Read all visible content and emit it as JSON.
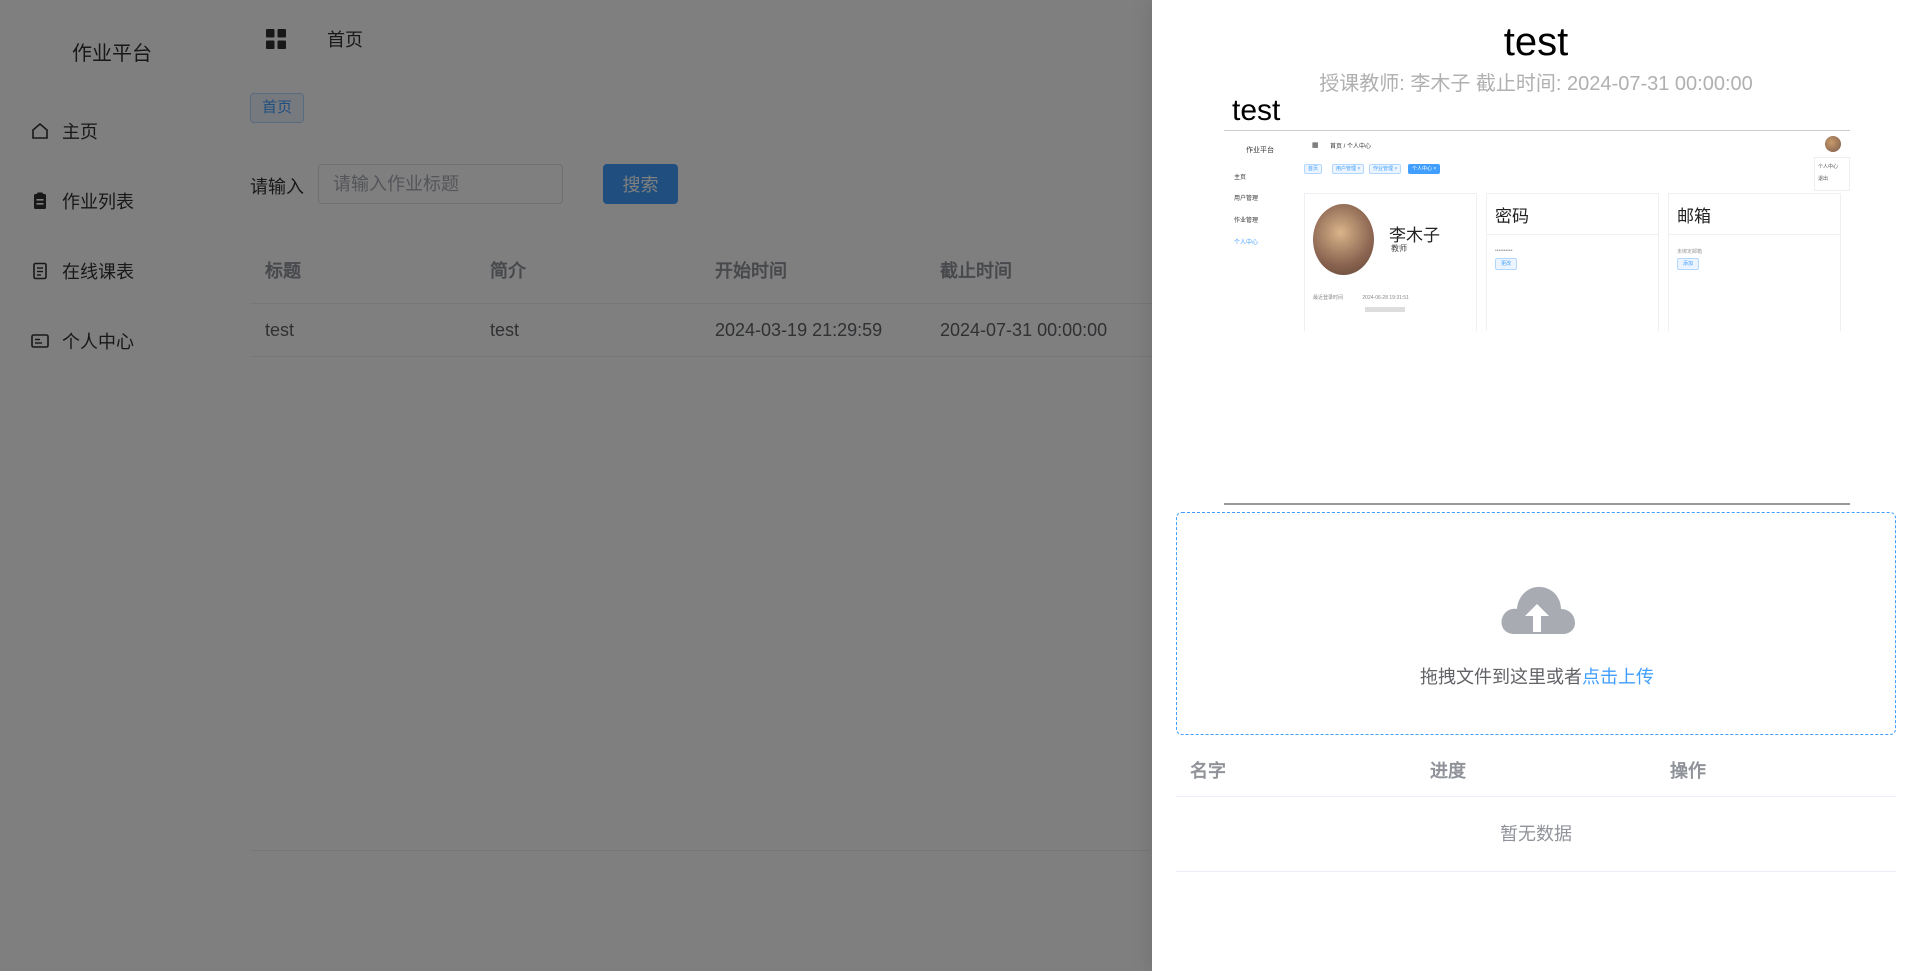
{
  "sidebar": {
    "brand": "作业平台",
    "items": [
      {
        "label": "主页",
        "icon": "home-icon"
      },
      {
        "label": "作业列表",
        "icon": "clipboard-icon"
      },
      {
        "label": "在线课表",
        "icon": "document-icon"
      },
      {
        "label": "个人中心",
        "icon": "id-card-icon"
      }
    ]
  },
  "header": {
    "breadcrumb": "首页",
    "menu_icon": "grid-icon"
  },
  "tags": [
    {
      "label": "首页"
    }
  ],
  "search": {
    "label": "请输入",
    "placeholder": "请输入作业标题",
    "value": "",
    "button": "搜索"
  },
  "table": {
    "columns": [
      "标题",
      "简介",
      "开始时间",
      "截止时间"
    ],
    "rows": [
      [
        "test",
        "test",
        "2024-03-19 21:29:59",
        "2024-07-31 00:00:00"
      ]
    ]
  },
  "drawer": {
    "title": "test",
    "teacher_label": "授课教师:",
    "teacher": "李木子",
    "deadline_label": "截止时间:",
    "deadline": "2024-07-31 00:00:00",
    "content_heading": "test",
    "embedded_screenshot": {
      "brand": "作业平台",
      "menu": [
        "主页",
        "用户管理",
        "作业管理",
        "个人中心"
      ],
      "breadcrumb": "首页 / 个人中心",
      "tags": [
        "首页",
        "用户管理 ×",
        "作业管理 ×",
        "个人中心 ×"
      ],
      "popover": [
        "个人中心",
        "退出"
      ],
      "profile": {
        "name": "李木子",
        "role": "教师"
      },
      "profile_meta": [
        "最近登录时间",
        "2024-06-28 19:31:51"
      ],
      "cards": [
        {
          "title": "密码",
          "text": "••••••••••",
          "button": "更改"
        },
        {
          "title": "邮箱",
          "text": "未绑定邮箱",
          "button": "添加"
        }
      ]
    },
    "upload": {
      "text": "拖拽文件到这里或者",
      "link": "点击上传",
      "icon": "cloud-upload-icon"
    },
    "file_table": {
      "columns": [
        "名字",
        "进度",
        "操作"
      ],
      "empty": "暂无数据"
    }
  },
  "colors": {
    "primary": "#409eff",
    "overlay": "rgba(0,0,0,0.5)",
    "text": "#303133",
    "muted": "#909399"
  }
}
